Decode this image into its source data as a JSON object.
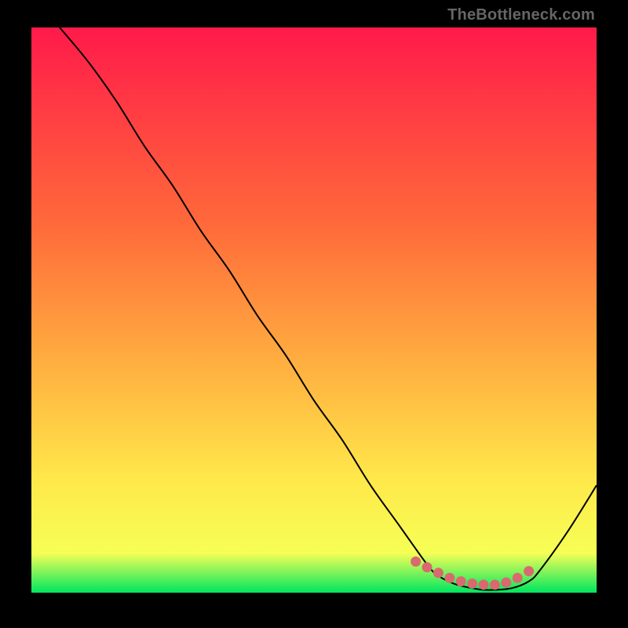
{
  "watermark": "TheBottleneck.com",
  "colors": {
    "background_black": "#000000",
    "gradient_top": "#ff1a4a",
    "gradient_mid": "#ffb040",
    "gradient_low": "#fff955",
    "gradient_bottom": "#00e660",
    "curve_stroke": "#000000",
    "dot_fill": "#d86a6f",
    "watermark_text": "#666666"
  },
  "chart_data": {
    "type": "line",
    "title": "",
    "xlabel": "",
    "ylabel": "",
    "xlim": [
      0,
      100
    ],
    "ylim": [
      0,
      100
    ],
    "grid": false,
    "legend": false,
    "series": [
      {
        "name": "bottleneck-curve",
        "x": [
          5,
          10,
          15,
          20,
          25,
          30,
          35,
          40,
          45,
          50,
          55,
          60,
          65,
          70,
          72,
          75,
          78,
          80,
          82,
          85,
          88,
          90,
          95,
          100
        ],
        "y": [
          100,
          94,
          87,
          79,
          72,
          64,
          57,
          49,
          42,
          34,
          27,
          19,
          12,
          5,
          3,
          1.5,
          0.8,
          0.5,
          0.5,
          0.8,
          2,
          4,
          11,
          19
        ]
      }
    ],
    "dot_region": {
      "name": "optimal-range",
      "x": [
        68,
        70,
        72,
        74,
        76,
        78,
        80,
        82,
        84,
        86,
        88
      ],
      "y": [
        5.5,
        4.5,
        3.5,
        2.6,
        2.0,
        1.6,
        1.4,
        1.4,
        1.8,
        2.6,
        3.8
      ]
    },
    "background_gradient": {
      "orientation": "vertical",
      "stops": [
        {
          "offset": 0.0,
          "color": "#ff1a4a"
        },
        {
          "offset": 0.35,
          "color": "#ff6a3a"
        },
        {
          "offset": 0.6,
          "color": "#ffb040"
        },
        {
          "offset": 0.8,
          "color": "#ffe84a"
        },
        {
          "offset": 0.93,
          "color": "#f6ff55"
        },
        {
          "offset": 1.0,
          "color": "#00e660"
        }
      ]
    }
  }
}
